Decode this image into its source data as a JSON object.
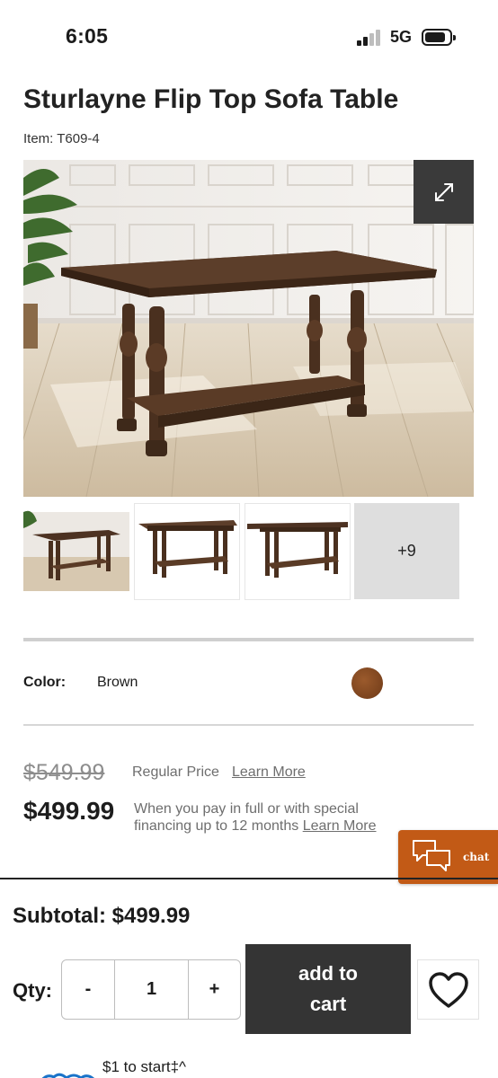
{
  "status_bar": {
    "time": "6:05",
    "network": "5G"
  },
  "product": {
    "title": "Sturlayne Flip Top Sofa Table",
    "item": "Item: T609-4"
  },
  "gallery": {
    "more_count": "+9",
    "expand_icon": "expand-icon"
  },
  "color": {
    "label": "Color:",
    "value": "Brown",
    "swatch_hex": "#7a4220"
  },
  "pricing": {
    "was_price": "$549.99",
    "regular_label": "Regular Price",
    "learn_more_1": "Learn More",
    "sale_price": "$499.99",
    "financing_text": "When you pay in full or with special financing up to 12 months ",
    "learn_more_2": "Learn More"
  },
  "chat": {
    "label": "chat"
  },
  "footer": {
    "subtotal": "Subtotal: $499.99",
    "qty_label": "Qty:",
    "qty_minus": "-",
    "qty_value": "1",
    "qty_plus": "+",
    "add_to_cart": "add to cart",
    "promo_text": "$1 to start‡^"
  },
  "colors": {
    "accent_chat": "#c25a16",
    "cart_button": "#343434",
    "wood": "#5a3b26"
  }
}
